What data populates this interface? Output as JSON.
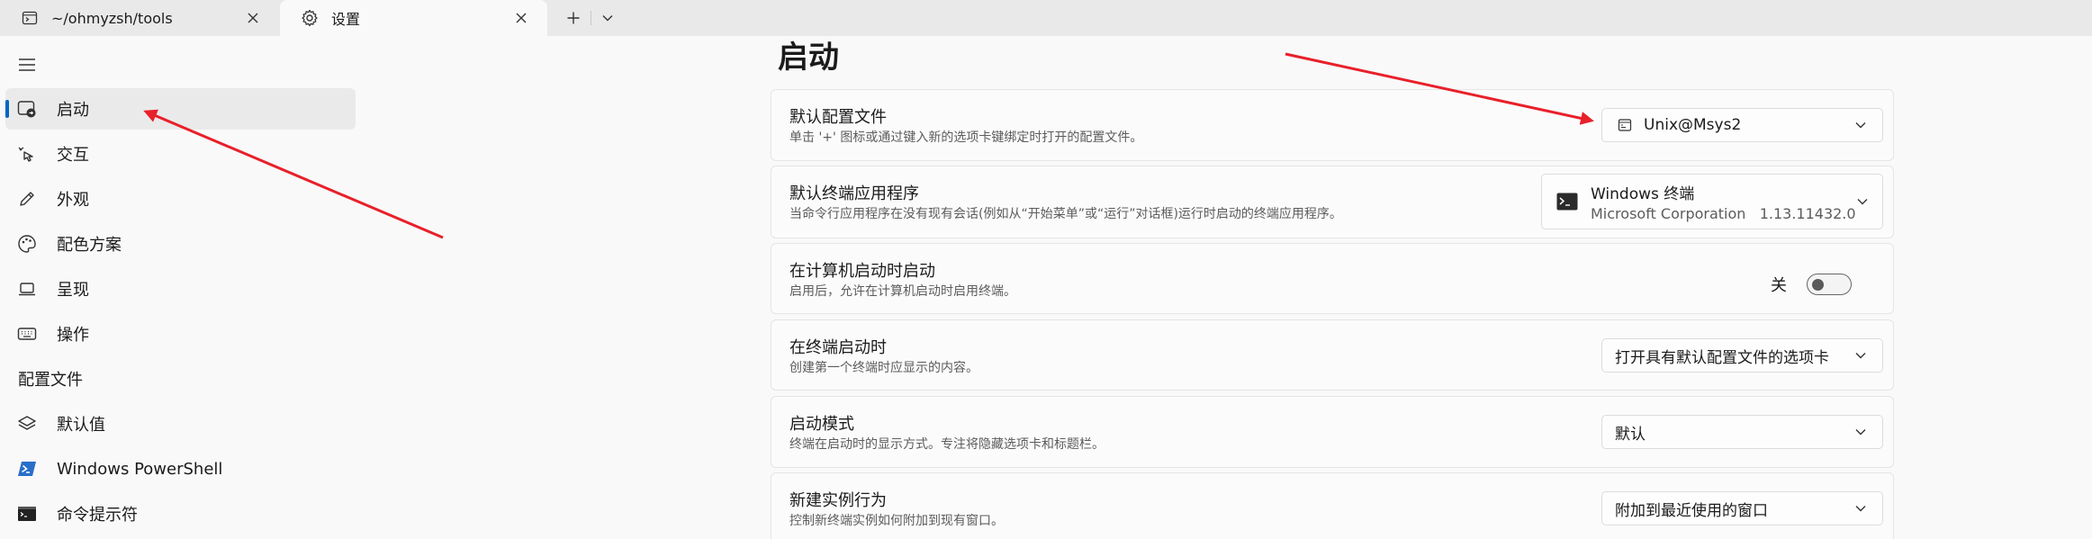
{
  "tabs": [
    {
      "label": "~/ohmyzsh/tools",
      "icon": "terminal-icon"
    },
    {
      "label": "设置",
      "icon": "gear-icon"
    }
  ],
  "sidebar": {
    "items": [
      {
        "label": "启动",
        "icon": "startup-icon",
        "selected": true
      },
      {
        "label": "交互",
        "icon": "interaction-icon"
      },
      {
        "label": "外观",
        "icon": "pen-icon"
      },
      {
        "label": "配色方案",
        "icon": "palette-icon"
      },
      {
        "label": "呈现",
        "icon": "laptop-icon"
      },
      {
        "label": "操作",
        "icon": "keyboard-icon"
      }
    ],
    "profiles_header": "配置文件",
    "profiles": [
      {
        "label": "默认值",
        "icon": "layers-icon"
      },
      {
        "label": "Windows PowerShell",
        "icon": "powershell-icon"
      },
      {
        "label": "命令提示符",
        "icon": "cmd-icon"
      }
    ]
  },
  "main": {
    "title": "启动",
    "settings": [
      {
        "title": "默认配置文件",
        "description": "单击 '+' 图标或通过键入新的选项卡键绑定时打开的配置文件。",
        "value": "Unix@Msys2"
      },
      {
        "title": "默认终端应用程序",
        "description": "当命令行应用程序在没有现有会话(例如从“开始菜单”或“运行”对话框)运行时启动的终端应用程序。",
        "value_line1": "Windows 终端",
        "value_line2": "Microsoft Corporation",
        "version": "1.13.11432.0"
      },
      {
        "title": "在计算机启动时启动",
        "description": "启用后，允许在计算机启动时启用终端。",
        "toggle_label": "关",
        "toggle_on": false
      },
      {
        "title": "在终端启动时",
        "description": "创建第一个终端时应显示的内容。",
        "value": "打开具有默认配置文件的选项卡"
      },
      {
        "title": "启动模式",
        "description": "终端在启动时的显示方式。专注将隐藏选项卡和标题栏。",
        "value": "默认"
      },
      {
        "title": "新建实例行为",
        "description": "控制新终端实例如何附加到现有窗口。",
        "value": "附加到最近使用的窗口"
      }
    ]
  },
  "colors": {
    "accent": "#0067c0",
    "annotation_arrow": "#e8202a"
  }
}
